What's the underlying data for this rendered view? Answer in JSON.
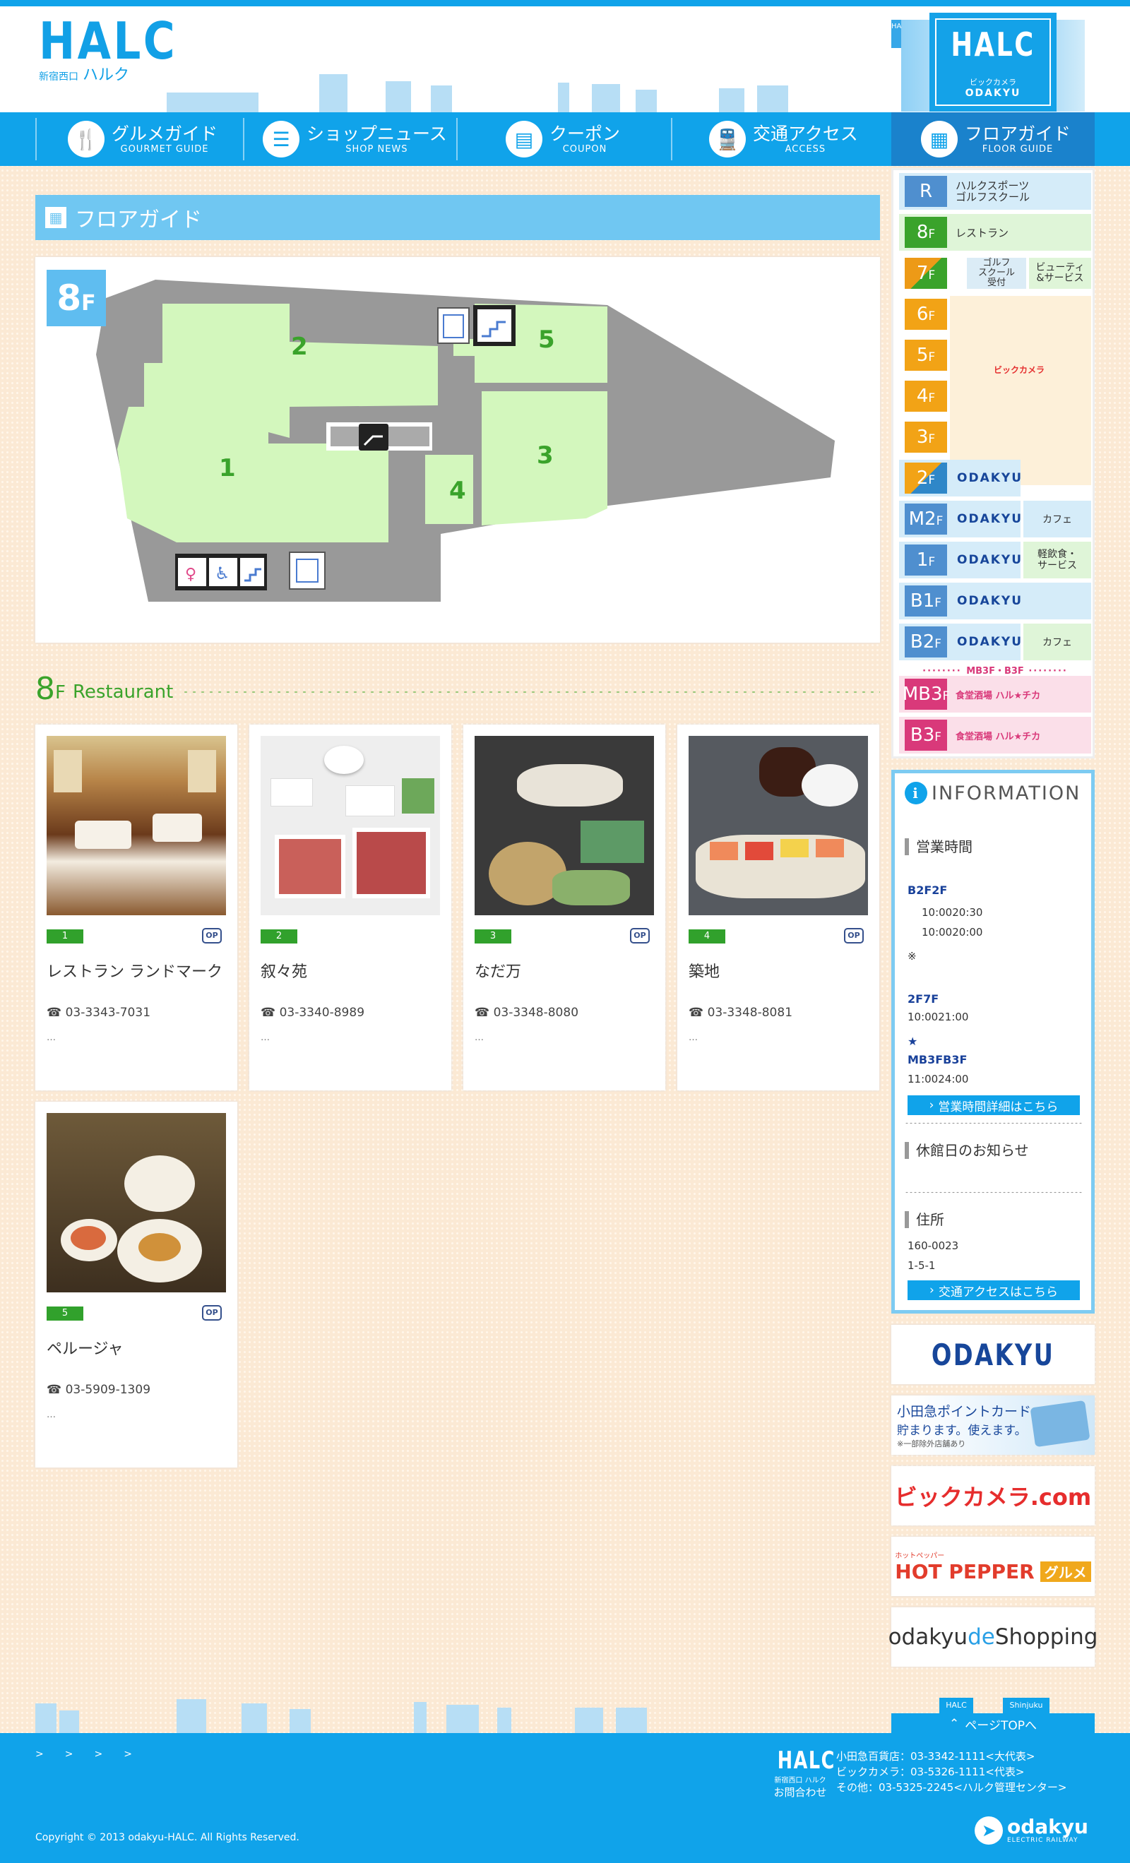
{
  "header": {
    "logo": "HALC",
    "logo_sub_small": "新宿西口",
    "logo_sub": "ハルク",
    "tower_logo": "HALC",
    "tower_sub1": "ビックカメラ",
    "tower_sub2": "ODAKYU",
    "tower_mini": "HAL"
  },
  "nav": {
    "items": [
      {
        "label": "グルメガイド",
        "en": "GOURMET GUIDE",
        "icon": "fork-knife-icon"
      },
      {
        "label": "ショップニュース",
        "en": "SHOP NEWS",
        "icon": "document-icon"
      },
      {
        "label": "クーポン",
        "en": "COUPON",
        "icon": "ticket-icon"
      },
      {
        "label": "交通アクセス",
        "en": "ACCESS",
        "icon": "train-icon"
      },
      {
        "label": "フロアガイド",
        "en": "FLOOR GUIDE",
        "icon": "building-icon"
      }
    ]
  },
  "page": {
    "title": "フロアガイド",
    "floor_badge": "8",
    "floor_badge_suffix": "F",
    "map_areas": [
      "1",
      "2",
      "3",
      "4",
      "5"
    ]
  },
  "section": {
    "num": "8",
    "f": "F",
    "label": "Restaurant"
  },
  "restaurants": [
    {
      "num": "1",
      "name": "レストラン ランドマーク",
      "tel": "☎ 03-3343-7031",
      "more": "…",
      "op": "OP"
    },
    {
      "num": "2",
      "name": "叙々苑",
      "tel": "☎ 03-3340-8989",
      "more": "…",
      "op": "OP"
    },
    {
      "num": "3",
      "name": "なだ万",
      "tel": "☎ 03-3348-8080",
      "more": "…",
      "op": "OP"
    },
    {
      "num": "4",
      "name": "築地",
      "tel": "☎ 03-3348-8081",
      "more": "…",
      "op": "OP"
    },
    {
      "num": "5",
      "name": "ペルージャ",
      "tel": "☎ 03-5909-1309",
      "more": "…",
      "op": "OP"
    }
  ],
  "floors": [
    {
      "label": "R",
      "suffix": "",
      "color": "#4f8fcf",
      "text": "ハルクスポーツ\nゴルフスクール",
      "bg": "#d5ecf9"
    },
    {
      "label": "8",
      "suffix": "F",
      "color": "#3aa32b",
      "text": "レストラン",
      "bg": "#dff5d8"
    },
    {
      "label": "7",
      "suffix": "F",
      "color": "#ed9a17",
      "text": "ゴルフ\nスクール\n受付",
      "text2": "ビューティ\n&サービス",
      "bg": "#fcefd6"
    },
    {
      "label": "6",
      "suffix": "F",
      "color": "#f2a316"
    },
    {
      "label": "5",
      "suffix": "F",
      "color": "#f2a316"
    },
    {
      "label": "4",
      "suffix": "F",
      "color": "#f2a316"
    },
    {
      "label": "3",
      "suffix": "F",
      "color": "#f2a316"
    },
    {
      "label": "2",
      "suffix": "F",
      "color": "#2f87c8",
      "odk": "ODAKYU"
    },
    {
      "label": "M2",
      "suffix": "F",
      "color": "#4f8fcf",
      "odk": "ODAKYU",
      "text": "カフェ"
    },
    {
      "label": "1",
      "suffix": "F",
      "color": "#4f8fcf",
      "odk": "ODAKYU",
      "text": "軽飲食・\nサービス"
    },
    {
      "label": "B1",
      "suffix": "F",
      "color": "#4f8fcf",
      "odk": "ODAKYU"
    },
    {
      "label": "B2",
      "suffix": "F",
      "color": "#4f8fcf",
      "odk": "ODAKYU",
      "text": "カフェ"
    },
    {
      "label": "MB3",
      "suffix": "F",
      "color": "#d9397a",
      "text": "食堂酒場 ハル★チカ"
    },
    {
      "label": "B3",
      "suffix": "F",
      "color": "#d9397a",
      "text": "食堂酒場 ハル★チカ"
    }
  ],
  "sidebar": {
    "bic_label": "ビックカメラ",
    "mb3_divider": "MB3F・B3F"
  },
  "info": {
    "title": "INFORMATION",
    "hours_head": "営業時間",
    "b2f2f": "B2F2F",
    "t1": "10:0020:30",
    "t2": "10:0020:00",
    "note": "※",
    "f27": "2F7F",
    "t3": "10:0021:00",
    "star": "★",
    "mb3": "MB3FB3F",
    "t4": "11:0024:00",
    "btn1": "営業時間詳細はこちら",
    "closed_head": "休館日のお知らせ",
    "addr_head": "住所",
    "zip": "160-0023",
    "addr": "1-5-1",
    "btn2": "交通アクセスはこちら"
  },
  "banners": {
    "odakyu": "ODAKYU",
    "points1": "小田急ポイントカード",
    "points2": "貯まります。使えます。",
    "points3": "※一部除外店舗あり",
    "bic": "ビックカメラ.com",
    "hp1": "ホットペッパー",
    "hp2": "HOT PEPPER",
    "hp3": "グルメ",
    "shop1": "odakyu",
    "shop2": "de",
    "shop3": "Shopping"
  },
  "footer": {
    "pagetop": "ページTOPへ",
    "pt_tag1": "HALC",
    "pt_tag2": "Shinjuku",
    "links": [
      ">",
      ">",
      ">",
      ">"
    ],
    "halc": "HALC",
    "halc_sub": "新宿西口 ハルク",
    "contact_label": "お問合わせ",
    "c1": "小田急百貨店：03-3342-1111<大代表>",
    "c2": "ビックカメラ：03-5326-1111<代表>",
    "c3": "その他：03-5325-2245<ハルク管理センター>",
    "copyright": "Copyright © 2013 odakyu-HALC. All Rights Reserved.",
    "odakyu": "odakyu",
    "odakyu_sub": "ELECTRIC RAILWAY"
  }
}
